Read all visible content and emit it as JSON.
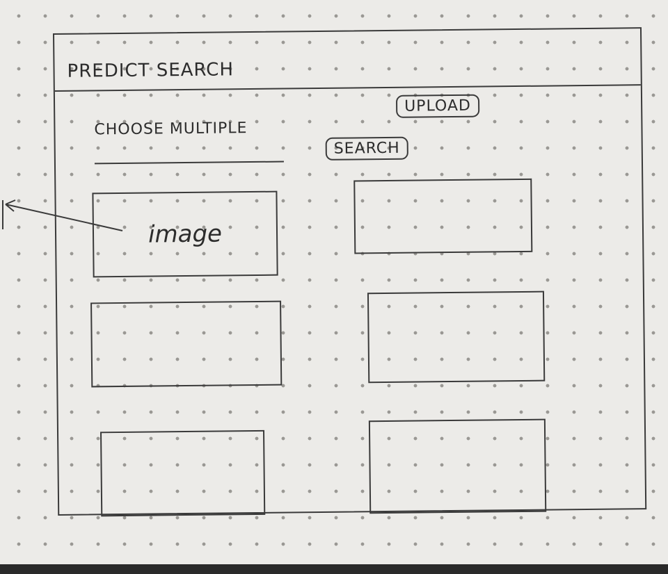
{
  "header": {
    "title": "PREDICT  SEARCH"
  },
  "controls": {
    "choose_label": "CHOOSE MULTIPLE",
    "upload_label": "UPLOAD",
    "search_label": "SEARCH"
  },
  "results": {
    "tiles": [
      {
        "label": "image"
      },
      {
        "label": ""
      },
      {
        "label": ""
      },
      {
        "label": ""
      },
      {
        "label": ""
      },
      {
        "label": ""
      }
    ]
  }
}
